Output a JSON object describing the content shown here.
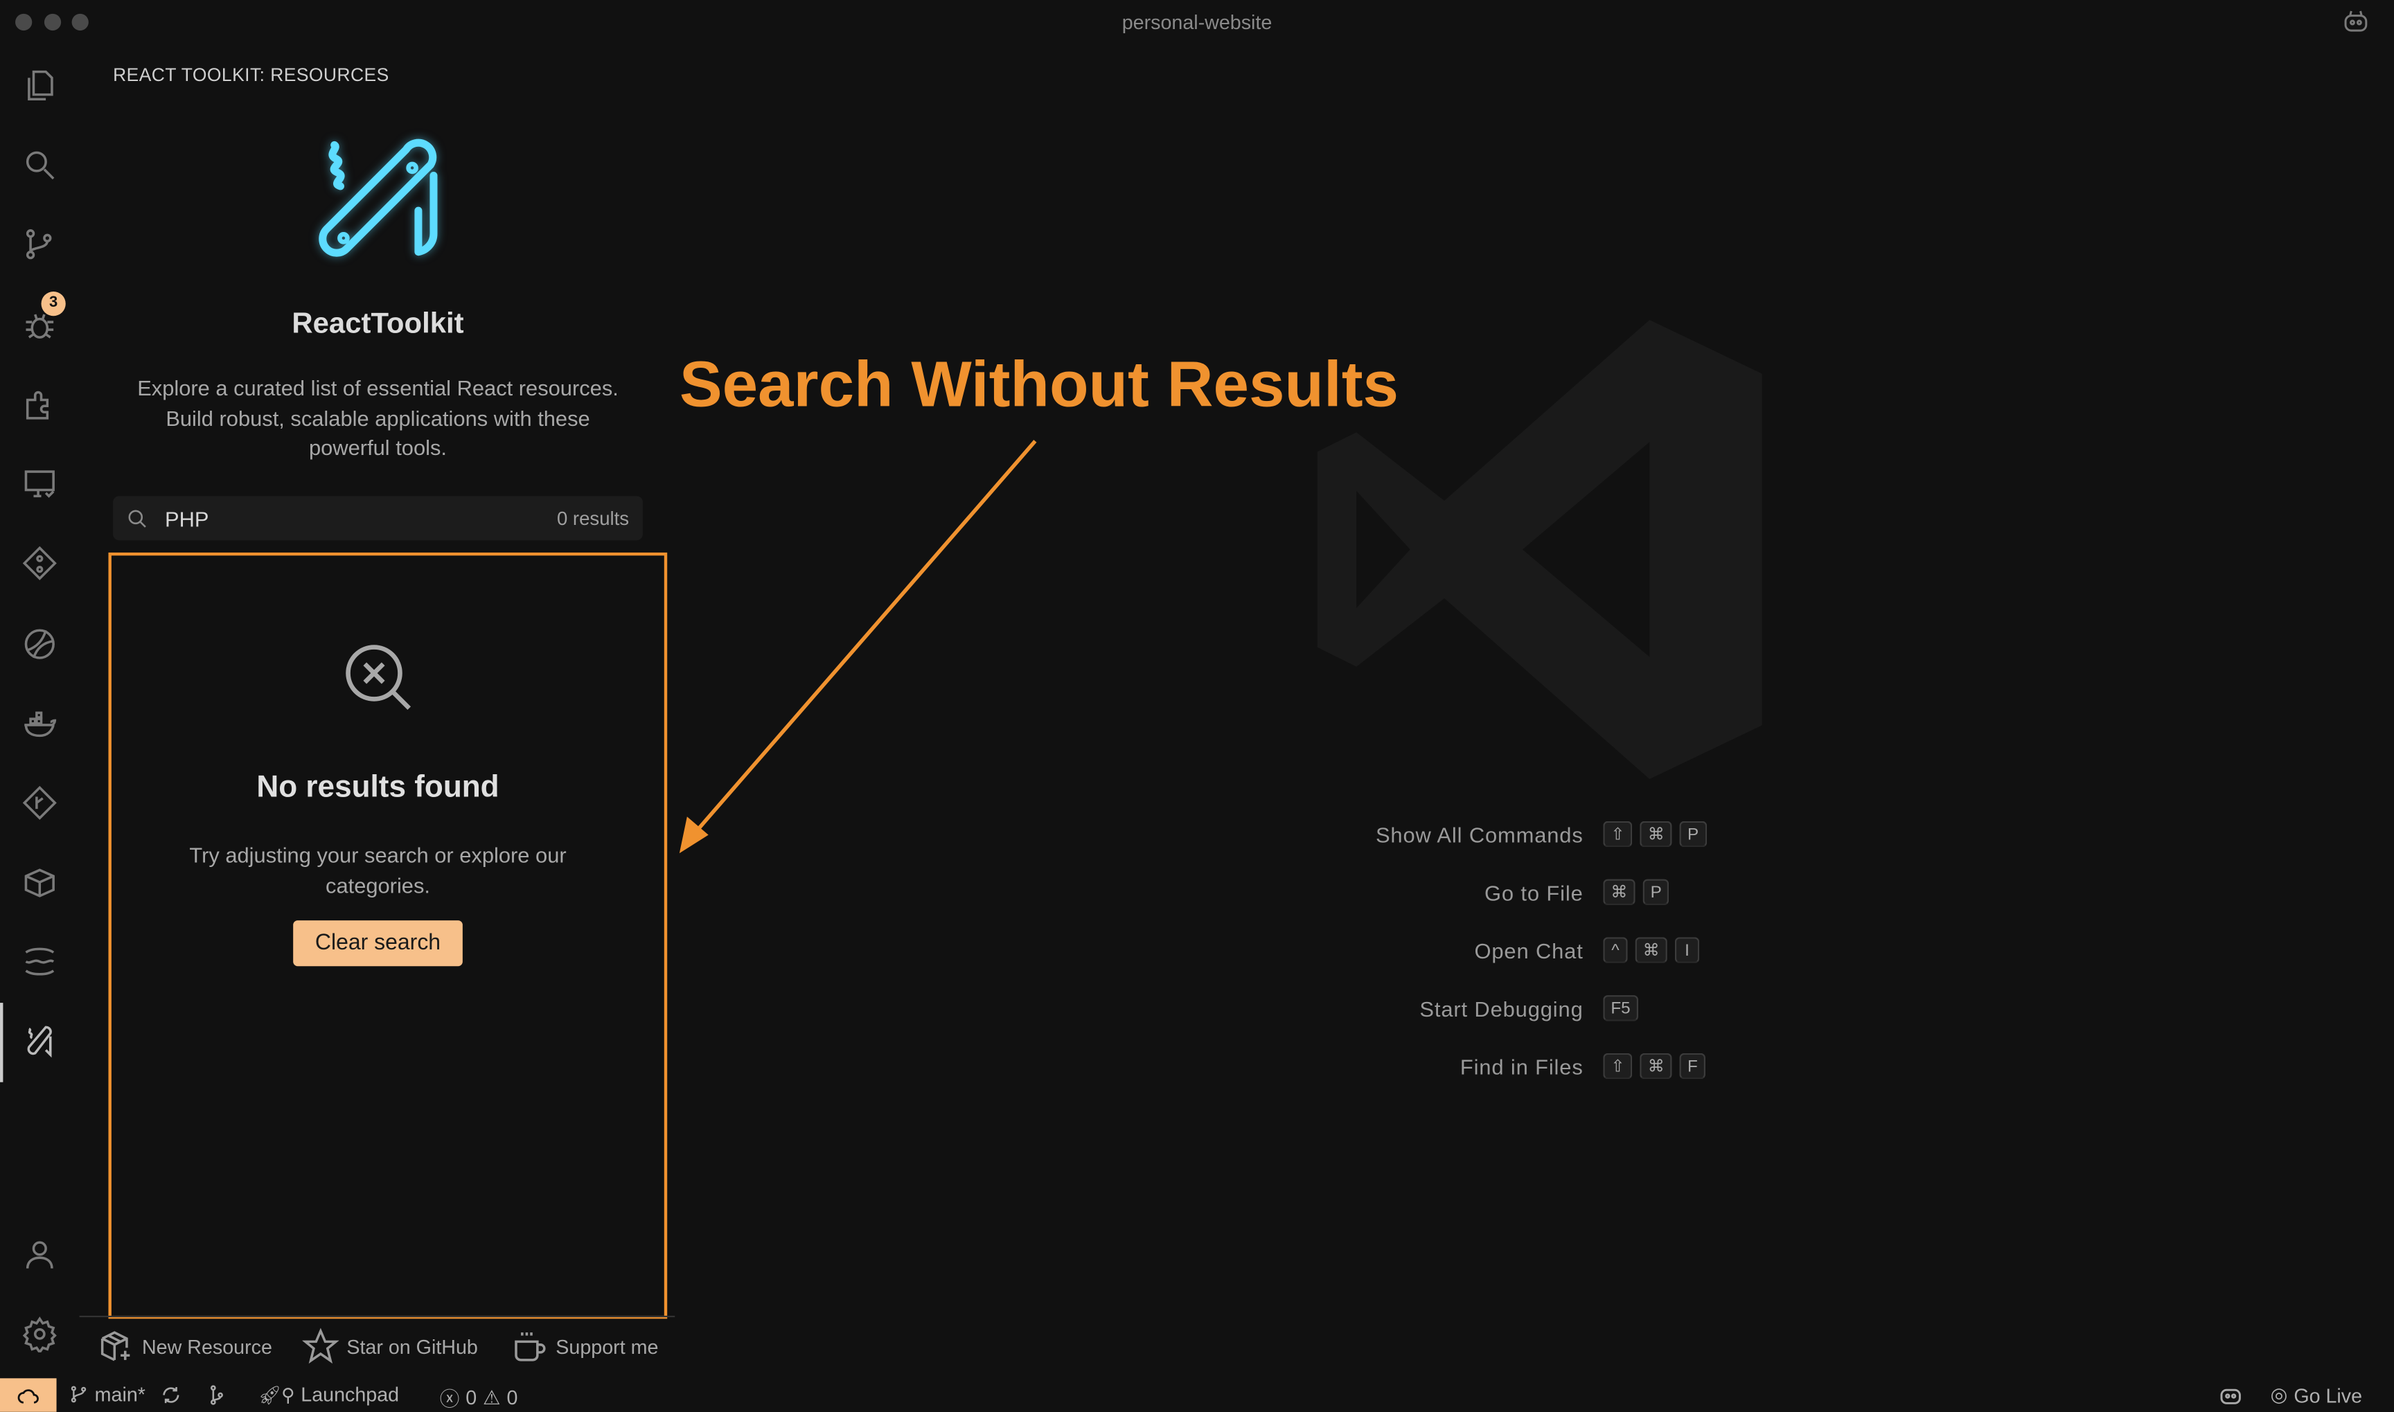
{
  "window": {
    "title": "personal-website"
  },
  "activity_bar": {
    "items": [
      {
        "icon": "files-icon"
      },
      {
        "icon": "search-icon"
      },
      {
        "icon": "source-control-icon",
        "badge": "3"
      },
      {
        "icon": "debug-icon"
      },
      {
        "icon": "extensions-icon"
      },
      {
        "icon": "remote-explorer-icon"
      },
      {
        "icon": "git-graph-icon"
      },
      {
        "icon": "ball-icon"
      },
      {
        "icon": "docker-icon"
      },
      {
        "icon": "gitlens-icon"
      },
      {
        "icon": "package-icon"
      },
      {
        "icon": "wave-icon"
      },
      {
        "icon": "react-toolkit-icon",
        "active": true
      }
    ],
    "bottom": [
      {
        "icon": "account-icon"
      },
      {
        "icon": "gear-icon"
      }
    ]
  },
  "sidebar": {
    "title": "REACT TOOLKIT: RESOURCES",
    "brand_name": "ReactToolkit",
    "logo_color": "#5ddcff",
    "description": "Explore a curated list of essential React resources. Build robust, scalable applications with these powerful tools.",
    "search": {
      "value": "PHP",
      "results": "0 results"
    },
    "empty_state": {
      "title": "No results found",
      "message": "Try adjusting your search or explore our categories.",
      "button": "Clear search"
    },
    "footer": [
      {
        "label": "New Resource",
        "icon": "package-plus-icon"
      },
      {
        "label": "Star on GitHub",
        "icon": "star-icon"
      },
      {
        "label": "Support me",
        "icon": "coffee-icon"
      }
    ]
  },
  "annotation": {
    "title": "Search Without Results",
    "color": "#f0922f"
  },
  "editor": {
    "shortcuts": [
      {
        "label": "Show All Commands",
        "keys": [
          "⇧",
          "⌘",
          "P"
        ]
      },
      {
        "label": "Go to File",
        "keys": [
          "⌘",
          "P"
        ]
      },
      {
        "label": "Open Chat",
        "keys": [
          "^",
          "⌘",
          "I"
        ]
      },
      {
        "label": "Start Debugging",
        "keys": [
          "F5"
        ]
      },
      {
        "label": "Find in Files",
        "keys": [
          "⇧",
          "⌘",
          "F"
        ]
      }
    ]
  },
  "status_bar": {
    "branch": "main*",
    "launchpad": "Launchpad",
    "errors": "0",
    "warnings": "0",
    "go_live": "Go Live",
    "remote_color": "#f7c08a"
  }
}
